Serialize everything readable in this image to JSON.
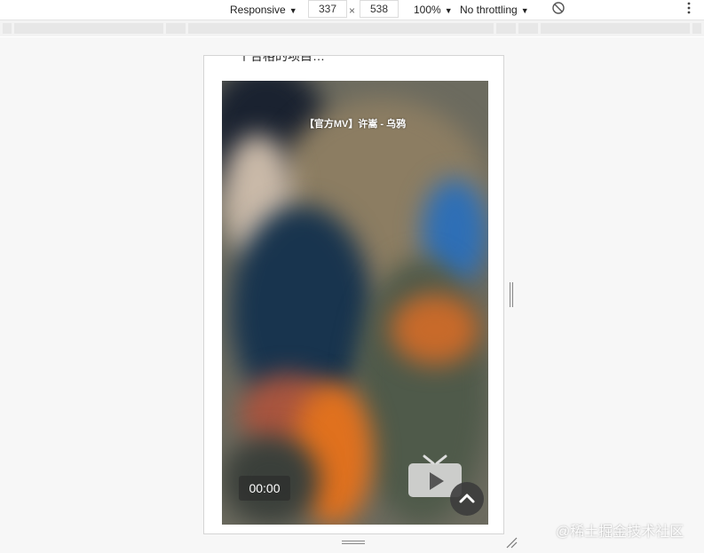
{
  "toolbar": {
    "device_label": "Responsive",
    "width_value": "337",
    "times_sign": "×",
    "height_value": "538",
    "zoom_label": "100%",
    "throttle_label": "No throttling",
    "dropdown_glyph": "▼",
    "rotate_icon": "rotate-icon",
    "more_icon": "more-vertical-icon"
  },
  "page": {
    "cut_text": "一个合格的项目…",
    "video": {
      "title": "【官方MV】许嵩 - 乌鸦",
      "current_time": "00:00",
      "tv_icon": "tv-icon",
      "scroll_top_icon": "chevron-up-icon"
    }
  },
  "watermark": "@稀土掘金技术社区",
  "colors": {
    "toolbar_bg": "#ffffff",
    "workspace_bg": "#f7f7f7",
    "device_border": "#d5d5d5",
    "badge_bg": "#282828"
  }
}
